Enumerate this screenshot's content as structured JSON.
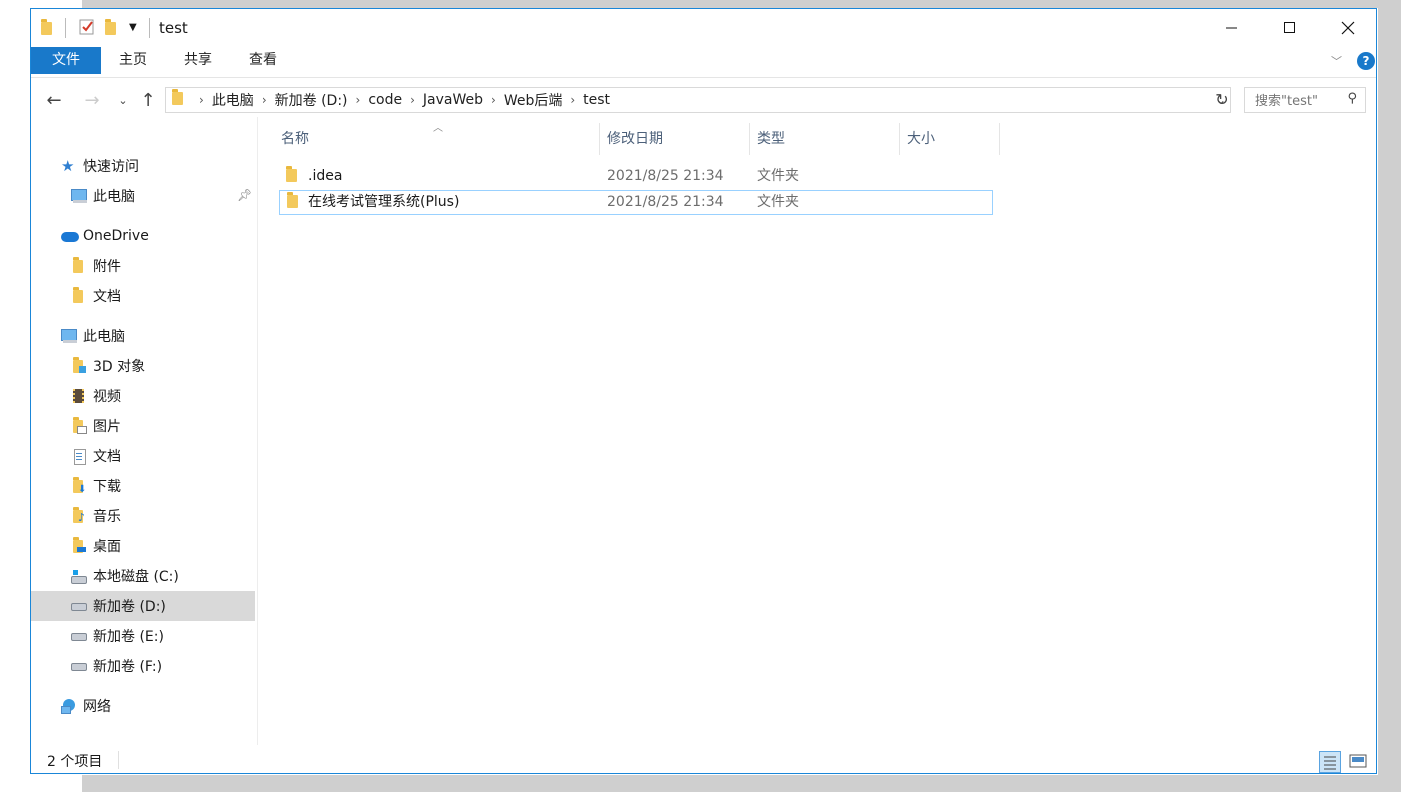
{
  "window": {
    "title": "test"
  },
  "ribbon": {
    "tabs": [
      "文件",
      "主页",
      "共享",
      "查看"
    ]
  },
  "address": {
    "crumbs": [
      "此电脑",
      "新加卷 (D:)",
      "code",
      "JavaWeb",
      "Web后端",
      "test"
    ]
  },
  "search": {
    "placeholder": "搜索\"test\""
  },
  "nav": {
    "quick_access": "快速访问",
    "qa_items": [
      "此电脑"
    ],
    "onedrive": "OneDrive",
    "onedrive_items": [
      "附件",
      "文档"
    ],
    "this_pc": "此电脑",
    "pc_items": [
      "3D 对象",
      "视频",
      "图片",
      "文档",
      "下载",
      "音乐",
      "桌面",
      "本地磁盘 (C:)",
      "新加卷 (D:)",
      "新加卷 (E:)",
      "新加卷 (F:)"
    ],
    "network": "网络"
  },
  "columns": {
    "name": "名称",
    "modified": "修改日期",
    "type": "类型",
    "size": "大小"
  },
  "files": [
    {
      "name": ".idea",
      "modified": "2021/8/25 21:34",
      "type": "文件夹"
    },
    {
      "name": "在线考试管理系统(Plus)",
      "modified": "2021/8/25 21:34",
      "type": "文件夹"
    }
  ],
  "status": {
    "count": "2 个项目"
  },
  "colors": {
    "accent": "#1979ca",
    "selection": "#d9d9d9",
    "folder": "#f3c95c"
  }
}
